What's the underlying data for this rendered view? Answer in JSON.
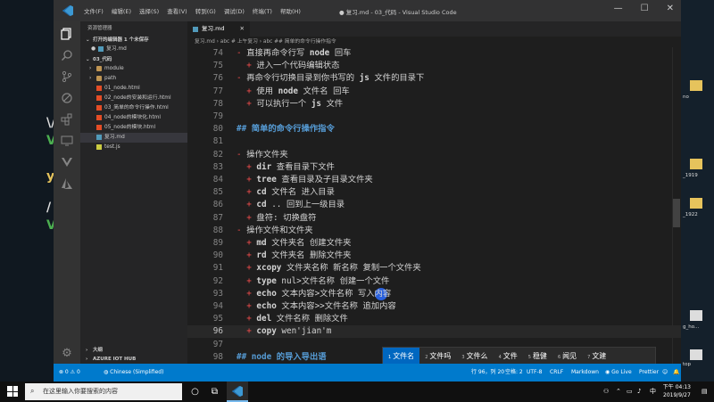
{
  "window": {
    "title": "● 复习.md - 03_代码 - Visual Studio Code",
    "menu": [
      "文件(F)",
      "编辑(E)",
      "选择(S)",
      "查看(V)",
      "转到(G)",
      "调试(D)",
      "终端(T)",
      "帮助(H)"
    ],
    "controls": {
      "minimize": "—",
      "maximize": "☐",
      "close": "✕"
    }
  },
  "sidebar": {
    "title": "资源管理器",
    "open_editors": "打开的编辑器  1 个未保存",
    "open_file": "复习.md",
    "root": "03_代码",
    "items": [
      {
        "label": "module",
        "type": "folder"
      },
      {
        "label": "path",
        "type": "folder"
      },
      {
        "label": "01_node.html",
        "type": "html"
      },
      {
        "label": "02_node的安装和运行.html",
        "type": "html"
      },
      {
        "label": "03_简单的命令行操作.html",
        "type": "html"
      },
      {
        "label": "04_node的模块化.html",
        "type": "html"
      },
      {
        "label": "05_node的模块.html",
        "type": "html"
      },
      {
        "label": "复习.md",
        "type": "md"
      },
      {
        "label": "test.js",
        "type": "js"
      }
    ],
    "outline": "大纲",
    "azure": "AZURE IOT HUB"
  },
  "tab": {
    "label": "复习.md",
    "close": "✕"
  },
  "breadcrumb": "复习.md › abc # 上午复习 › abc ## 简单的命令行操作指令",
  "editor": {
    "lines": [
      {
        "n": "74",
        "parts": [
          [
            "b",
            "- "
          ],
          [
            "t",
            "直接再命令行写 "
          ],
          [
            "k",
            "node"
          ],
          [
            "t",
            " 回车"
          ]
        ]
      },
      {
        "n": "75",
        "parts": [
          [
            "t",
            "  "
          ],
          [
            "b",
            "+ "
          ],
          [
            "t",
            "进入一个代码编辑状态"
          ]
        ]
      },
      {
        "n": "76",
        "parts": [
          [
            "b",
            "- "
          ],
          [
            "t",
            "再命令行切换目录到你书写的 "
          ],
          [
            "k",
            "js"
          ],
          [
            "t",
            " 文件的目录下"
          ]
        ]
      },
      {
        "n": "77",
        "parts": [
          [
            "t",
            "  "
          ],
          [
            "b",
            "+ "
          ],
          [
            "t",
            "使用 "
          ],
          [
            "k",
            "node"
          ],
          [
            "t",
            " 文件名 回车"
          ]
        ]
      },
      {
        "n": "78",
        "parts": [
          [
            "t",
            "  "
          ],
          [
            "b",
            "+ "
          ],
          [
            "t",
            "可以执行一个 "
          ],
          [
            "k",
            "js"
          ],
          [
            "t",
            " 文件"
          ]
        ]
      },
      {
        "n": "79",
        "parts": []
      },
      {
        "n": "80",
        "parts": [
          [
            "h",
            "## 简单的命令行操作指令"
          ]
        ]
      },
      {
        "n": "81",
        "parts": []
      },
      {
        "n": "82",
        "parts": [
          [
            "b",
            "- "
          ],
          [
            "t",
            "操作文件夹"
          ]
        ]
      },
      {
        "n": "83",
        "parts": [
          [
            "t",
            "  "
          ],
          [
            "b",
            "+ "
          ],
          [
            "k",
            "dir"
          ],
          [
            "t",
            " 查看目录下文件"
          ]
        ]
      },
      {
        "n": "84",
        "parts": [
          [
            "t",
            "  "
          ],
          [
            "b",
            "+ "
          ],
          [
            "k",
            "tree"
          ],
          [
            "t",
            " 查看目录及子目录文件夹"
          ]
        ]
      },
      {
        "n": "85",
        "parts": [
          [
            "t",
            "  "
          ],
          [
            "b",
            "+ "
          ],
          [
            "k",
            "cd"
          ],
          [
            "t",
            " 文件名 进入目录"
          ]
        ]
      },
      {
        "n": "86",
        "parts": [
          [
            "t",
            "  "
          ],
          [
            "b",
            "+ "
          ],
          [
            "k",
            "cd"
          ],
          [
            "t",
            " .. 回到上一级目录"
          ]
        ]
      },
      {
        "n": "87",
        "parts": [
          [
            "t",
            "  "
          ],
          [
            "b",
            "+ "
          ],
          [
            "t",
            "盘符: 切换盘符"
          ]
        ]
      },
      {
        "n": "88",
        "parts": [
          [
            "b",
            "- "
          ],
          [
            "t",
            "操作文件和文件夹"
          ]
        ]
      },
      {
        "n": "89",
        "parts": [
          [
            "t",
            "  "
          ],
          [
            "b",
            "+ "
          ],
          [
            "k",
            "md"
          ],
          [
            "t",
            " 文件夹名 创建文件夹"
          ]
        ]
      },
      {
        "n": "90",
        "parts": [
          [
            "t",
            "  "
          ],
          [
            "b",
            "+ "
          ],
          [
            "k",
            "rd"
          ],
          [
            "t",
            " 文件夹名 删除文件夹"
          ]
        ]
      },
      {
        "n": "91",
        "parts": [
          [
            "t",
            "  "
          ],
          [
            "b",
            "+ "
          ],
          [
            "k",
            "xcopy"
          ],
          [
            "t",
            " 文件夹名称 新名称 复制一个文件夹"
          ]
        ]
      },
      {
        "n": "92",
        "parts": [
          [
            "t",
            "  "
          ],
          [
            "b",
            "+ "
          ],
          [
            "k",
            "type"
          ],
          [
            "t",
            " nul>文件名称 创建一个文件"
          ]
        ]
      },
      {
        "n": "93",
        "parts": [
          [
            "t",
            "  "
          ],
          [
            "b",
            "+ "
          ],
          [
            "k",
            "echo"
          ],
          [
            "t",
            " 文本内容>文件名称 写入内容"
          ]
        ]
      },
      {
        "n": "94",
        "parts": [
          [
            "t",
            "  "
          ],
          [
            "b",
            "+ "
          ],
          [
            "k",
            "echo"
          ],
          [
            "t",
            " 文本内容>>文件名称 追加内容"
          ]
        ]
      },
      {
        "n": "95",
        "parts": [
          [
            "t",
            "  "
          ],
          [
            "b",
            "+ "
          ],
          [
            "k",
            "del"
          ],
          [
            "t",
            " 文件名称 删除文件"
          ]
        ]
      },
      {
        "n": "96",
        "parts": [
          [
            "t",
            "  "
          ],
          [
            "b",
            "+ "
          ],
          [
            "k",
            "copy"
          ],
          [
            "t",
            " wen'jian'm"
          ]
        ],
        "current": true
      },
      {
        "n": "97",
        "parts": []
      },
      {
        "n": "98",
        "parts": [
          [
            "h",
            "## node 的导入导出语"
          ]
        ]
      }
    ]
  },
  "ime": {
    "candidates": [
      {
        "n": "1",
        "text": "文件名",
        "selected": true
      },
      {
        "n": "2",
        "text": "文件吗"
      },
      {
        "n": "3",
        "text": "文件么"
      },
      {
        "n": "4",
        "text": "文件"
      },
      {
        "n": "5",
        "text": "稳健"
      },
      {
        "n": "6",
        "text": "闻见"
      },
      {
        "n": "7",
        "text": "文建"
      }
    ]
  },
  "statusbar": {
    "errors": "⊗ 0 ⚠ 0",
    "lang_pack": "Chinese (Simplified)",
    "position": "行 96，列 20",
    "spaces": "空格: 2",
    "encoding": "UTF-8",
    "eol": "CRLF",
    "language": "Markdown",
    "live": "Go Live",
    "prettier": "Prettier"
  },
  "desktop": {
    "labels": [
      "no",
      "_1919",
      "_1922",
      "g_ho...",
      "top"
    ]
  },
  "taskbar": {
    "search_placeholder": "在这里输入你要搜索的内容",
    "time": "下午 04:13",
    "date": "2019/9/27",
    "lang": "中"
  },
  "colors": {
    "accent": "#007acc",
    "bullet": "#f14c4c",
    "heading": "#569cd6",
    "ime_selected": "#0067c0"
  }
}
